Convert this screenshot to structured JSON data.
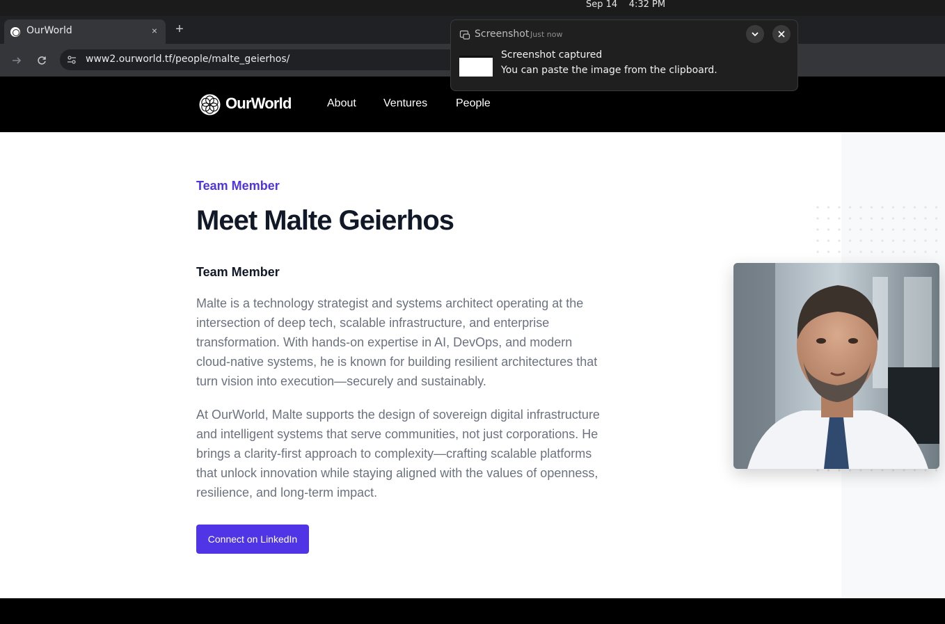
{
  "system": {
    "date": "Sep 14",
    "time": "4:32 PM"
  },
  "browser": {
    "tab_title": "OurWorld",
    "tab_close": "×",
    "new_tab": "+",
    "url": "www2.ourworld.tf/people/malte_geierhos/"
  },
  "site": {
    "brand": "OurWorld",
    "nav": [
      "About",
      "Ventures",
      "People"
    ]
  },
  "profile": {
    "eyebrow": "Team Member",
    "title": "Meet Malte Geierhos",
    "role": "Team Member",
    "paragraphs": [
      "Malte is a technology strategist and systems architect operating at the intersection of deep tech, scalable infrastructure, and enterprise transformation. With hands-on expertise in AI, DevOps, and modern cloud-native systems, he is known for building resilient architectures that turn vision into execution—securely and sustainably.",
      "At OurWorld, Malte supports the design of sovereign digital infrastructure and intelligent systems that serve communities, not just corporations. He brings a clarity-first approach to complexity—crafting scalable platforms that unlock innovation while staying aligned with the values of openness, resilience, and long-term impact."
    ],
    "cta_label": "Connect on LinkedIn"
  },
  "notification": {
    "app": "Screenshot",
    "time": "Just now",
    "heading": "Screenshot captured",
    "body": "You can paste the image from the clipboard."
  },
  "colors": {
    "accent": "#4f35e6",
    "heading": "#111827",
    "body_text": "#6b7280",
    "header_bg": "#000000"
  },
  "icons": [
    "ourworld-logo-icon",
    "back-icon",
    "forward-icon",
    "reload-icon",
    "site-info-icon",
    "screenshot-app-icon",
    "chevron-down-icon",
    "close-icon"
  ]
}
